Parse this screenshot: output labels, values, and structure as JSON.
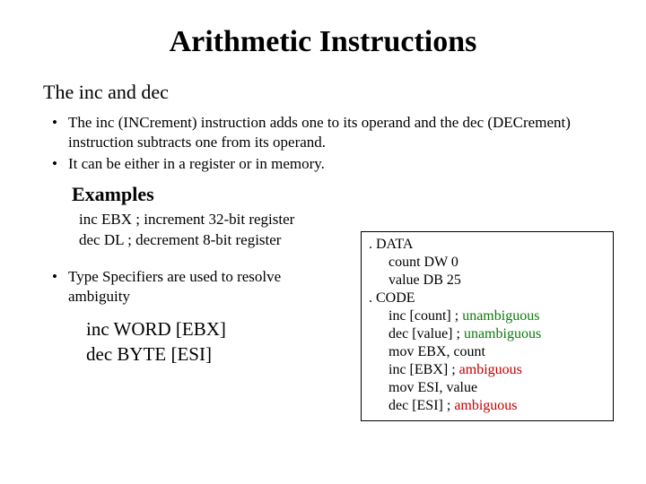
{
  "title": "Arithmetic Instructions",
  "subtitle": "The inc and dec",
  "bullet1": "The inc (INCrement) instruction adds one to its operand and the dec (DECrement) instruction subtracts one from its operand.",
  "bullet2": "It can be either in a register or in memory.",
  "examples_heading": "Examples",
  "example_line1": "inc  EBX ; increment 32-bit register",
  "example_line2": "dec DL   ; decrement 8-bit register",
  "bullet3": "Type Specifiers are used to resolve ambiguity",
  "typespec_line1": "inc  WORD [EBX]",
  "typespec_line2": "dec BYTE [ESI]",
  "code": {
    "l1": ". DATA",
    "l2": "count DW 0",
    "l3": "value DB 25",
    "l4": ". CODE",
    "l5a": "inc [count]   ; ",
    "l5b": "unambiguous",
    "l6a": "dec [value]   ; ",
    "l6b": "unambiguous",
    "l7": "mov EBX, count",
    "l8a": "inc [EBX]   ; ",
    "l8b": "ambiguous",
    "l9": "mov ESI, value",
    "l10a": "dec [ESI]   ; ",
    "l10b": "ambiguous"
  }
}
